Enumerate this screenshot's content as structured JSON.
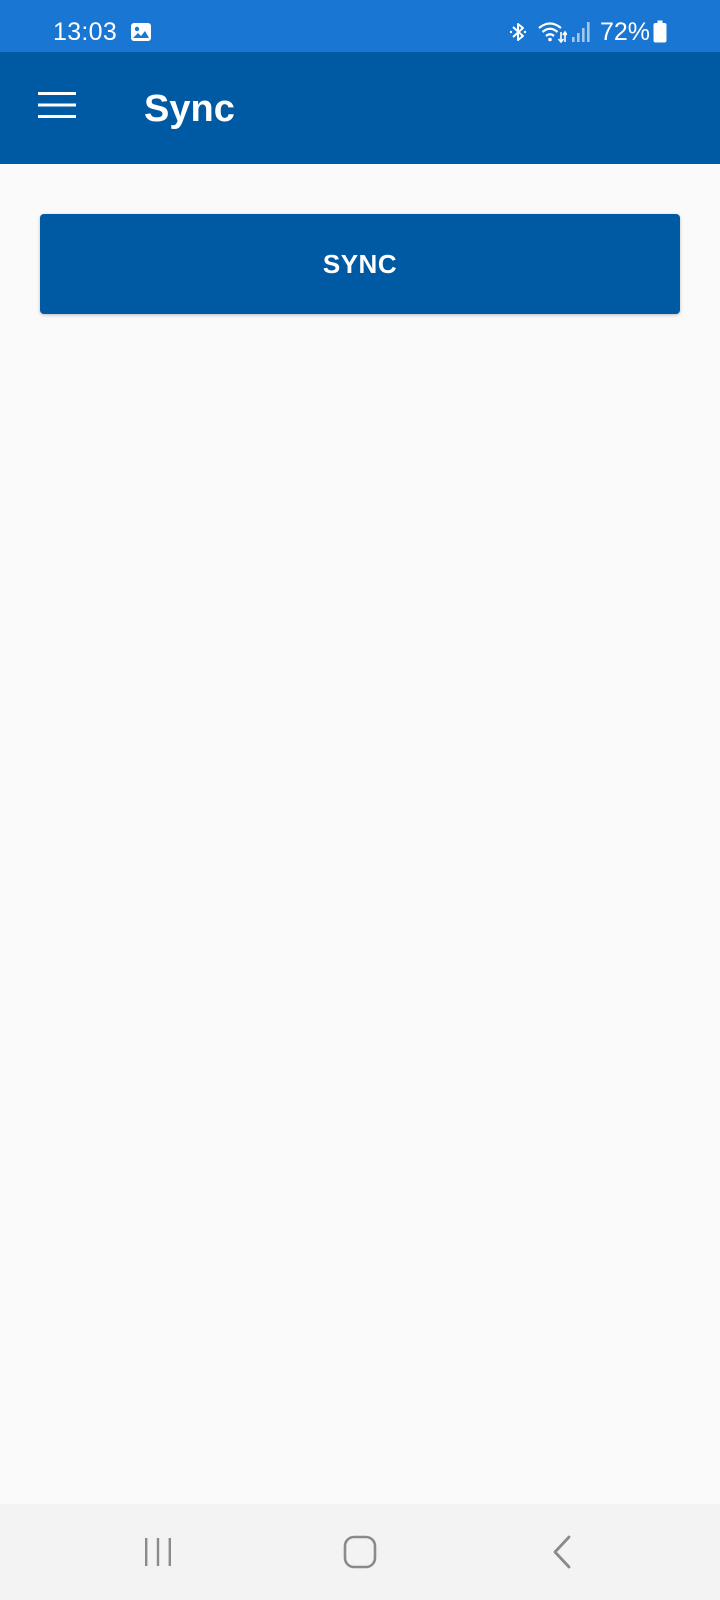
{
  "status_bar": {
    "time": "13:03",
    "battery_percent": "72%",
    "icons": [
      "gallery-icon",
      "bluetooth-icon",
      "wifi-icon",
      "signal-icon",
      "battery-icon"
    ],
    "background": "#1976d2"
  },
  "app_bar": {
    "title": "Sync",
    "menu_icon": "hamburger-menu-icon",
    "background": "#005aa3"
  },
  "main": {
    "sync_button_label": "SYNC",
    "button_color": "#005aa3",
    "background": "#fafafa"
  },
  "nav_bar": {
    "icons": [
      "recent-apps-icon",
      "home-icon",
      "back-icon"
    ],
    "background": "#f3f3f3"
  }
}
